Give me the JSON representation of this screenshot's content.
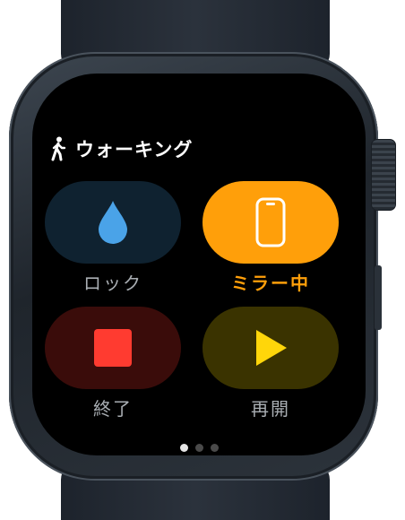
{
  "workout": {
    "title": "ウォーキング",
    "icon": "walking-figure-icon"
  },
  "controls": [
    {
      "id": "lock",
      "label": "ロック",
      "icon": "water-drop-icon",
      "color": "#4aa3e8"
    },
    {
      "id": "mirror",
      "label": "ミラー中",
      "icon": "iphone-icon",
      "color": "#ff9f0a",
      "active": true
    },
    {
      "id": "end",
      "label": "終了",
      "icon": "stop-square-icon",
      "color": "#ff3b30"
    },
    {
      "id": "resume",
      "label": "再開",
      "icon": "play-triangle-icon",
      "color": "#ffd60a"
    }
  ],
  "page_indicator": {
    "count": 3,
    "current": 1
  }
}
